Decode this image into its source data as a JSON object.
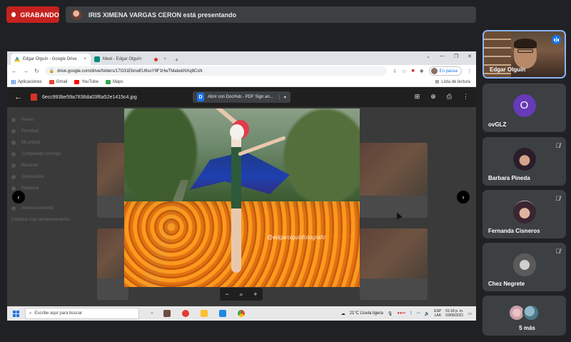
{
  "meet": {
    "recording_label": "GRABANDO",
    "presenting_text": "IRIS XIMENA VARGAS CERON está presentando"
  },
  "browser": {
    "tabs": [
      {
        "label": "Edgar Olguín - Google Drive",
        "close": "×"
      },
      {
        "label": "Meet - Edgar Olguín",
        "close": "×"
      }
    ],
    "new_tab": "+",
    "url": "drive.google.com/drive/folders/17O31EbnwEU6sxY9F1HwTMabxkNXq8CsN",
    "profile_status": "En pausa",
    "bookmarks": [
      "Aplicaciones",
      "Gmail",
      "YouTube",
      "Maps"
    ],
    "reading_list": "Lista de lectura"
  },
  "viewer": {
    "filename": "6ecc993be59a7836da03f6a52e1415c4.jpg",
    "open_with": "Abrir con DocHub - PDF Sign an...",
    "watermark": "@edgarolguinfotografo"
  },
  "drive_sidebar": [
    "Nuevo",
    "Prioridad",
    "Mi unidad",
    "Compartido conmigo",
    "Reciente",
    "Destacados",
    "Papelera",
    "Almacenamiento",
    "Comprar más almacenamiento"
  ],
  "taskbar": {
    "search_placeholder": "Escribe aquí para buscar",
    "weather": "21°C  Lluvia ligera",
    "lang": "ESP",
    "lang2": "LAA",
    "time": "01:18 p. m.",
    "date": "03/06/2021"
  },
  "participants": [
    {
      "name": "Edgar Olguín"
    },
    {
      "name": "ovGLZ",
      "initial": "O"
    },
    {
      "name": "Barbara Pineda"
    },
    {
      "name": "Fernanda Cisneros"
    },
    {
      "name": "Chez Negrete"
    },
    {
      "name": "5 más"
    }
  ],
  "colors": {
    "recording": "#c5221f",
    "meet_bg": "#202124",
    "tile_bg": "#3c4043",
    "accent": "#1a73e8",
    "avatar_purple": "#673ab7"
  }
}
